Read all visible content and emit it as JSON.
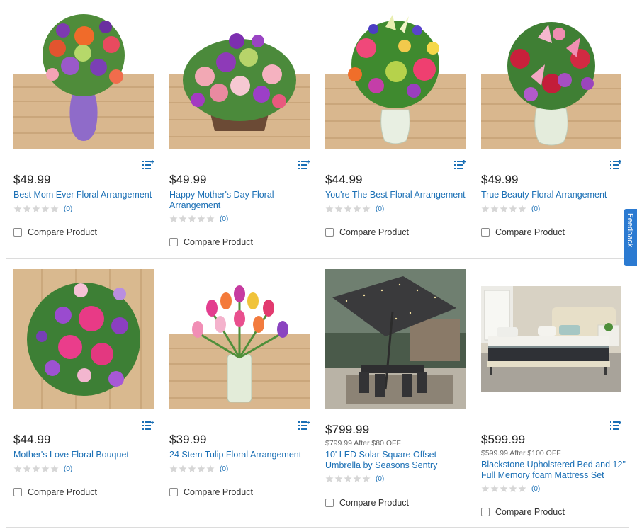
{
  "feedback": {
    "label": "Feedback"
  },
  "colors": {
    "link": "#1a6fb5",
    "feedback_tab": "#2b7ad1",
    "star_empty": "#d6d6d6"
  },
  "products": [
    {
      "price": "$49.99",
      "rebate": "",
      "title": "Best Mom Ever Floral Arrangement",
      "rating_count": "(0)",
      "compare_label": "Compare Product",
      "image": "purple-vase-bouquet"
    },
    {
      "price": "$49.99",
      "rebate": "",
      "title": "Happy Mother's Day Floral Arrangement",
      "rating_count": "(0)",
      "compare_label": "Compare Product",
      "image": "wooden-box-arrangement"
    },
    {
      "price": "$44.99",
      "rebate": "",
      "title": "You're The Best Floral Arrangement",
      "rating_count": "(0)",
      "compare_label": "Compare Product",
      "image": "glass-vase-mixed-bouquet"
    },
    {
      "price": "$49.99",
      "rebate": "",
      "title": "True Beauty Floral Arrangement",
      "rating_count": "(0)",
      "compare_label": "Compare Product",
      "image": "lily-rose-bouquet"
    },
    {
      "price": "$44.99",
      "rebate": "",
      "title": "Mother's Love Floral Bouquet",
      "rating_count": "(0)",
      "compare_label": "Compare Product",
      "image": "wrapped-bouquet-top-view"
    },
    {
      "price": "$39.99",
      "rebate": "",
      "title": "24 Stem Tulip Floral Arrangement",
      "rating_count": "(0)",
      "compare_label": "Compare Product",
      "image": "tulip-vase"
    },
    {
      "price": "$799.99",
      "rebate": "$799.99 After $80 OFF",
      "title": "10' LED Solar Square Offset Umbrella by Seasons Sentry",
      "rating_count": "(0)",
      "compare_label": "Compare Product",
      "image": "patio-umbrella"
    },
    {
      "price": "$599.99",
      "rebate": "$599.99 After $100 OFF",
      "title": "Blackstone Upholstered Bed and 12\" Full Memory foam Mattress Set",
      "rating_count": "(0)",
      "compare_label": "Compare Product",
      "image": "bed-mattress"
    }
  ]
}
